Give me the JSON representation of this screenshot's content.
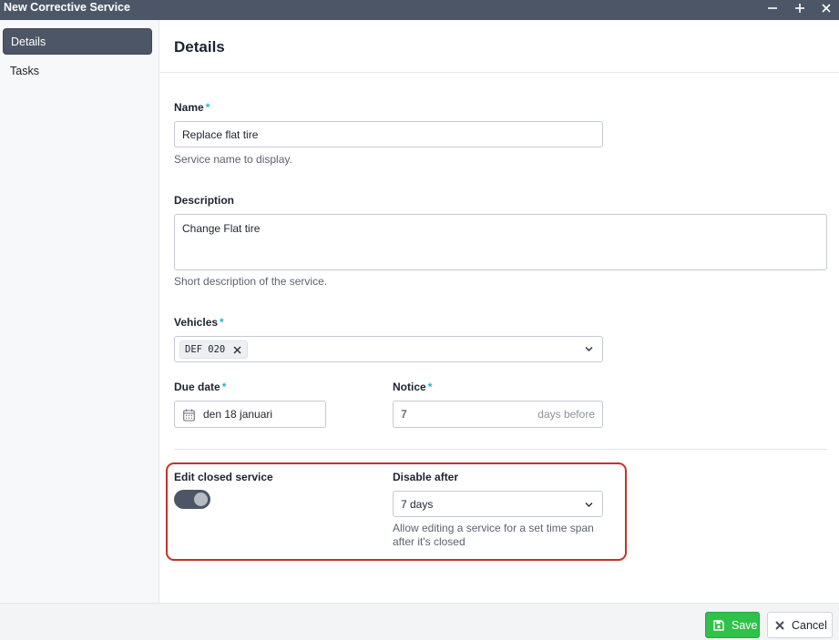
{
  "window": {
    "title": "New Corrective Service",
    "minimize_icon": "minus-icon",
    "maximize_icon": "plus-icon",
    "close_icon": "close-icon"
  },
  "sidebar": {
    "items": [
      {
        "label": "Details",
        "active": true
      },
      {
        "label": "Tasks",
        "active": false
      }
    ]
  },
  "main": {
    "heading": "Details",
    "name": {
      "label": "Name",
      "required": "*",
      "value": "Replace flat tire",
      "help": "Service name to display."
    },
    "description": {
      "label": "Description",
      "value": "Change Flat tire",
      "help": "Short description of the service."
    },
    "vehicles": {
      "label": "Vehicles",
      "required": "*",
      "chips": [
        "DEF 020"
      ]
    },
    "due_date": {
      "label": "Due date",
      "required": "*",
      "value": "den 18 januari",
      "icon": "calendar-icon"
    },
    "notice": {
      "label": "Notice",
      "required": "*",
      "value": "7",
      "suffix": "days before"
    },
    "edit_closed": {
      "label": "Edit closed service",
      "enabled": true
    },
    "disable_after": {
      "label": "Disable after",
      "value": "7 days",
      "help_line1": "Allow editing a service for a set time span",
      "help_line2": "after it's closed"
    }
  },
  "footer": {
    "save_label": "Save",
    "cancel_label": "Cancel"
  },
  "colors": {
    "titlebar": "#4c5666",
    "accent_required": "#27b0d6",
    "save_button": "#2fc14a",
    "highlight_border": "#c3322b"
  }
}
